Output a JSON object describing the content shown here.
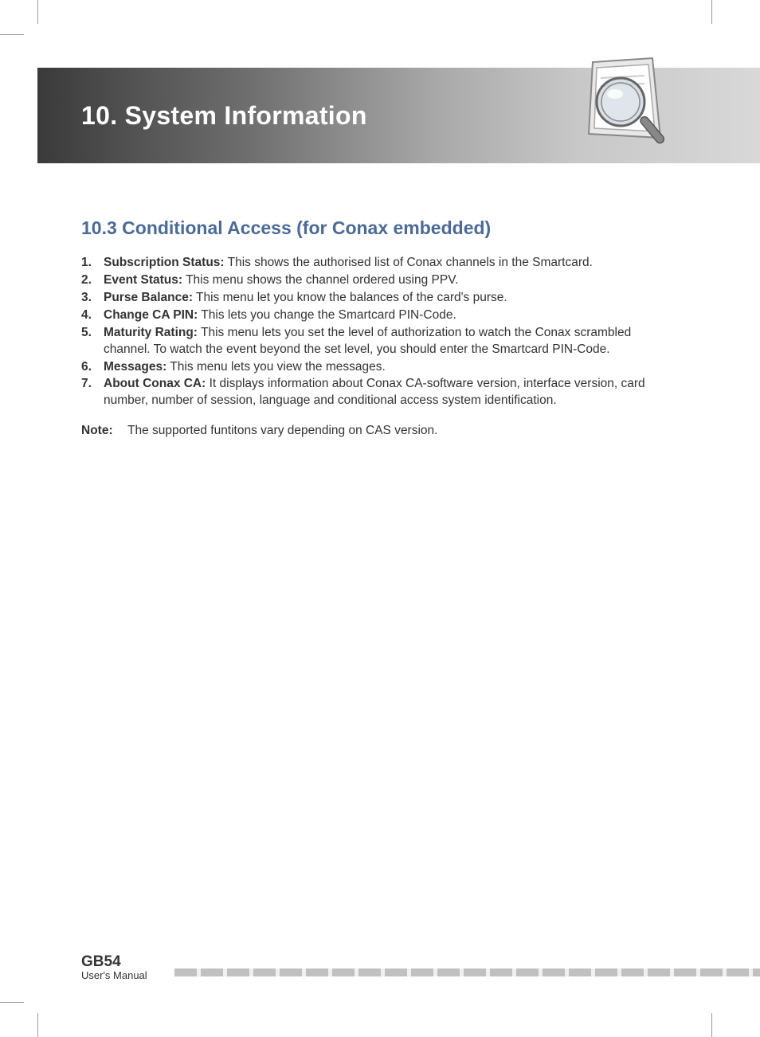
{
  "header": {
    "chapter_title": "10. System Information"
  },
  "section": {
    "title": "10.3 Conditional Access (for Conax embedded)",
    "items": [
      {
        "term": "Subscription Status:",
        "desc": " This shows the authorised list of Conax channels in the Smartcard."
      },
      {
        "term": "Event Status:",
        "desc": " This menu shows the channel ordered using PPV."
      },
      {
        "term": "Purse Balance:",
        "desc": " This menu let you know the balances of the card's purse."
      },
      {
        "term": "Change CA PIN:",
        "desc": " This lets you change the Smartcard PIN-Code."
      },
      {
        "term": "Maturity Rating:",
        "desc": " This menu lets you set the level of authorization to watch the Conax scrambled channel. To watch the event beyond the set level, you should enter the Smartcard PIN-Code."
      },
      {
        "term": "Messages:",
        "desc": " This menu lets you view the messages."
      },
      {
        "term": "About Conax CA:",
        "desc": " It displays information about Conax CA-software version, interface version, card number, number of session, language and conditional access system identification."
      }
    ],
    "note_label": "Note:",
    "note_text": "The supported funtitons vary depending on CAS version."
  },
  "footer": {
    "page_number": "GB54",
    "manual_label": "User's Manual"
  }
}
